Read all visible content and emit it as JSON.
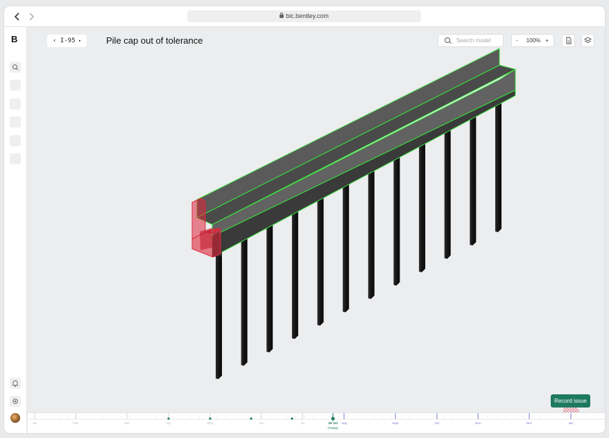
{
  "browser": {
    "url": "bic.bentley.com",
    "back_icon": "chevron-left-icon",
    "forward_icon": "chevron-right-icon"
  },
  "sidebar": {
    "logo": "B",
    "items": [
      {
        "icon": "search-icon"
      },
      {
        "icon": "placeholder-icon"
      },
      {
        "icon": "placeholder-icon"
      },
      {
        "icon": "placeholder-icon"
      },
      {
        "icon": "placeholder-icon"
      },
      {
        "icon": "placeholder-icon"
      }
    ],
    "bottom": [
      {
        "icon": "bell-icon"
      },
      {
        "icon": "gear-icon"
      },
      {
        "icon": "avatar"
      }
    ]
  },
  "toolbar": {
    "project": "I-95",
    "title": "Pile cap out of tolerance",
    "search_placeholder": "Search model",
    "zoom_minus": "-",
    "zoom_value": "100%",
    "zoom_plus": "+"
  },
  "timeline": {
    "months": [
      "Jan",
      "Feb",
      "Mar",
      "Apr",
      "May",
      "Jun",
      "Jul",
      "Aug",
      "Sept",
      "Oct",
      "Nov",
      "Dec",
      "Jan"
    ],
    "today_label": "26 Jul",
    "today_sub": "(Today)"
  },
  "actions": {
    "record_issue": "Record issue"
  },
  "colors": {
    "accent_green": "#1e7a5f",
    "selection_green": "#39e23c",
    "issue_red": "#e0283c",
    "timeline_future": "#5a5acf"
  }
}
